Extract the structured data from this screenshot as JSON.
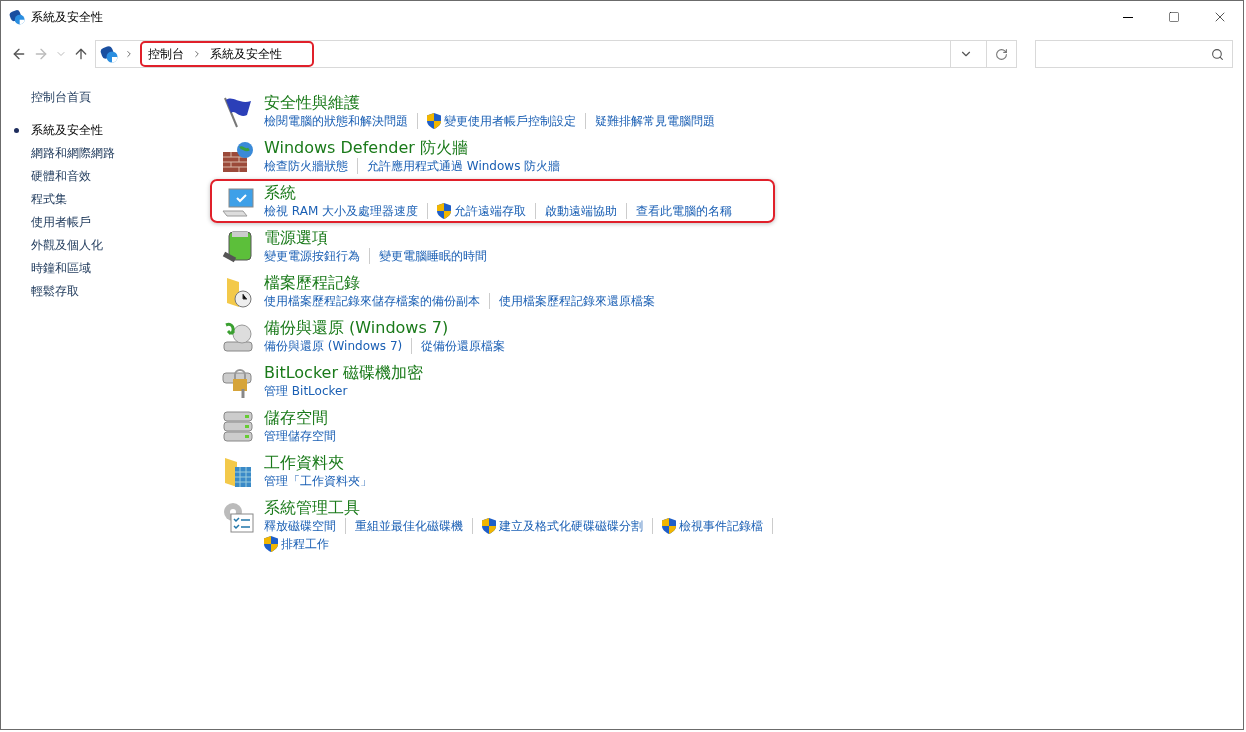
{
  "window": {
    "title": "系統及安全性"
  },
  "address_bar": {
    "breadcrumbs": [
      "控制台",
      "系統及安全性"
    ],
    "highlighted": true
  },
  "sidebar": {
    "home": "控制台首頁",
    "items": [
      {
        "label": "系統及安全性",
        "selected": true
      },
      {
        "label": "網路和網際網路",
        "selected": false
      },
      {
        "label": "硬體和音效",
        "selected": false
      },
      {
        "label": "程式集",
        "selected": false
      },
      {
        "label": "使用者帳戶",
        "selected": false
      },
      {
        "label": "外觀及個人化",
        "selected": false
      },
      {
        "label": "時鐘和區域",
        "selected": false
      },
      {
        "label": "輕鬆存取",
        "selected": false
      }
    ]
  },
  "categories": [
    {
      "title": "安全性與維護",
      "highlighted": false,
      "links": [
        {
          "label": "檢閱電腦的狀態和解決問題",
          "shield": false
        },
        {
          "label": "變更使用者帳戶控制設定",
          "shield": true
        },
        {
          "label": "疑難排解常見電腦問題",
          "shield": false
        }
      ]
    },
    {
      "title": "Windows Defender 防火牆",
      "highlighted": false,
      "links": [
        {
          "label": "檢查防火牆狀態",
          "shield": false
        },
        {
          "label": "允許應用程式通過 Windows 防火牆",
          "shield": false
        }
      ]
    },
    {
      "title": "系統",
      "highlighted": true,
      "links": [
        {
          "label": "檢視 RAM 大小及處理器速度",
          "shield": false
        },
        {
          "label": "允許遠端存取",
          "shield": true
        },
        {
          "label": "啟動遠端協助",
          "shield": false
        },
        {
          "label": "查看此電腦的名稱",
          "shield": false
        }
      ]
    },
    {
      "title": "電源選項",
      "highlighted": false,
      "links": [
        {
          "label": "變更電源按鈕行為",
          "shield": false
        },
        {
          "label": "變更電腦睡眠的時間",
          "shield": false
        }
      ]
    },
    {
      "title": "檔案歷程記錄",
      "highlighted": false,
      "links": [
        {
          "label": "使用檔案歷程記錄來儲存檔案的備份副本",
          "shield": false
        },
        {
          "label": "使用檔案歷程記錄來還原檔案",
          "shield": false
        }
      ]
    },
    {
      "title": "備份與還原 (Windows 7)",
      "highlighted": false,
      "links": [
        {
          "label": "備份與還原 (Windows 7)",
          "shield": false
        },
        {
          "label": "從備份還原檔案",
          "shield": false
        }
      ]
    },
    {
      "title": "BitLocker 磁碟機加密",
      "highlighted": false,
      "links": [
        {
          "label": "管理 BitLocker",
          "shield": false
        }
      ]
    },
    {
      "title": "儲存空間",
      "highlighted": false,
      "links": [
        {
          "label": "管理儲存空間",
          "shield": false
        }
      ]
    },
    {
      "title": "工作資料夾",
      "highlighted": false,
      "links": [
        {
          "label": "管理「工作資料夾」",
          "shield": false
        }
      ]
    },
    {
      "title": "系統管理工具",
      "highlighted": false,
      "links": [
        {
          "label": "釋放磁碟空間",
          "shield": false
        },
        {
          "label": "重組並最佳化磁碟機",
          "shield": false
        },
        {
          "label": "建立及格式化硬碟磁碟分割",
          "shield": true
        },
        {
          "label": "檢視事件記錄檔",
          "shield": true
        },
        {
          "label": "排程工作",
          "shield": true
        }
      ]
    }
  ]
}
